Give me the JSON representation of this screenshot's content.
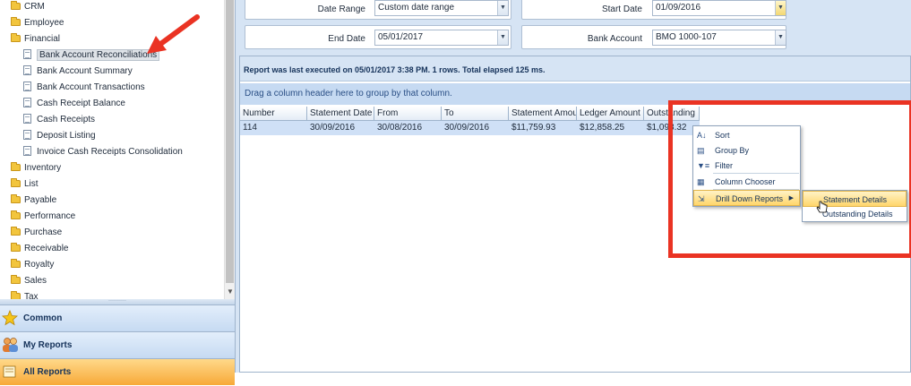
{
  "tree": {
    "items": [
      {
        "label": "CRM",
        "type": "folder"
      },
      {
        "label": "Employee",
        "type": "folder"
      },
      {
        "label": "Financial",
        "type": "folder"
      },
      {
        "label": "Bank Account Reconciliations",
        "type": "report",
        "selected": true
      },
      {
        "label": "Bank Account Summary",
        "type": "report"
      },
      {
        "label": "Bank Account Transactions",
        "type": "report"
      },
      {
        "label": "Cash Receipt Balance",
        "type": "report"
      },
      {
        "label": "Cash Receipts",
        "type": "report"
      },
      {
        "label": "Deposit Listing",
        "type": "report"
      },
      {
        "label": "Invoice Cash Receipts Consolidation",
        "type": "report"
      },
      {
        "label": "Inventory",
        "type": "folder"
      },
      {
        "label": "List",
        "type": "folder"
      },
      {
        "label": "Payable",
        "type": "folder"
      },
      {
        "label": "Performance",
        "type": "folder"
      },
      {
        "label": "Purchase",
        "type": "folder"
      },
      {
        "label": "Receivable",
        "type": "folder"
      },
      {
        "label": "Royalty",
        "type": "folder"
      },
      {
        "label": "Sales",
        "type": "folder"
      },
      {
        "label": "Tax",
        "type": "folder"
      }
    ]
  },
  "nav": {
    "common": "Common",
    "my_reports": "My Reports",
    "all_reports": "All Reports"
  },
  "params": {
    "date_range_label": "Date Range",
    "date_range_value": "Custom date range",
    "start_date_label": "Start Date",
    "start_date_value": "01/09/2016",
    "end_date_label": "End Date",
    "end_date_value": "05/01/2017",
    "bank_account_label": "Bank Account",
    "bank_account_value": "BMO 1000-107"
  },
  "report": {
    "status": "Report was last executed on 05/01/2017 3:38 PM. 1 rows. Total elapsed 125 ms.",
    "group_hint": "Drag a column header here to group by that column."
  },
  "grid": {
    "columns": [
      "Number",
      "Statement Date",
      "From",
      "To",
      "Statement Amou",
      "Ledger Amount",
      "Outstanding"
    ],
    "rows": [
      [
        "114",
        "30/09/2016",
        "30/08/2016",
        "30/09/2016",
        "$11,759.93",
        "$12,858.25",
        "$1,098.32"
      ]
    ]
  },
  "context_menu": {
    "items": [
      {
        "label": "Sort",
        "icon": "sort-icon"
      },
      {
        "label": "Group By",
        "icon": "group-by-icon"
      },
      {
        "label": "Filter",
        "icon": "filter-icon"
      },
      {
        "label": "Column Chooser",
        "icon": "column-chooser-icon"
      },
      {
        "label": "Drill Down Reports",
        "icon": "drill-down-icon",
        "has_submenu": true
      }
    ],
    "submenu": [
      "Statement Details",
      "Outstanding Details"
    ]
  },
  "colors": {
    "annotation_red": "#ea3323",
    "accent_blue": "#c6daf2",
    "highlight_orange": "#f7a938"
  }
}
